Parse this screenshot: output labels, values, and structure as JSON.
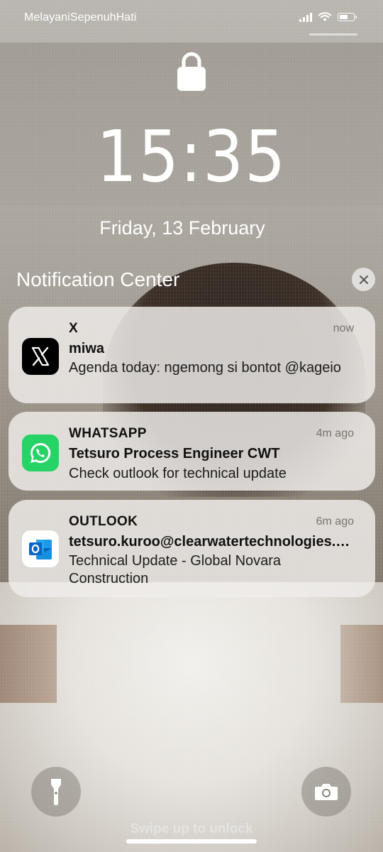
{
  "status_bar": {
    "carrier": "MelayaniSepenuhHati",
    "signal_bars": 4,
    "wifi": "wifi-icon",
    "battery_level": 0.5
  },
  "lock_screen": {
    "lock_icon": "lock-icon",
    "time": "15:35",
    "date": "Friday, 13 February"
  },
  "notification_center": {
    "title": "Notification Center",
    "close_icon": "close-icon"
  },
  "notifications": [
    {
      "app": "X",
      "icon": "x-app-icon",
      "time": "now",
      "sender": "miwa",
      "body": "Agenda today: ngemong si bontot @kageio"
    },
    {
      "app": "WHATSAPP",
      "icon": "whatsapp-app-icon",
      "time": "4m ago",
      "sender": "Tetsuro Process Engineer CWT",
      "body": "Check outlook for technical update"
    },
    {
      "app": "OUTLOOK",
      "icon": "outlook-app-icon",
      "time": "6m ago",
      "sender": "tetsuro.kuroo@clearwatertechnologies.com",
      "body": "Technical Update - Global Novara Construction"
    }
  ],
  "bottom": {
    "flashlight_icon": "flashlight-icon",
    "camera_icon": "camera-icon",
    "swipe_hint": "Swipe up to unlock"
  },
  "colors": {
    "whatsapp_green": "#25D366",
    "outlook_blue": "#0A64C8",
    "x_black": "#000000"
  }
}
